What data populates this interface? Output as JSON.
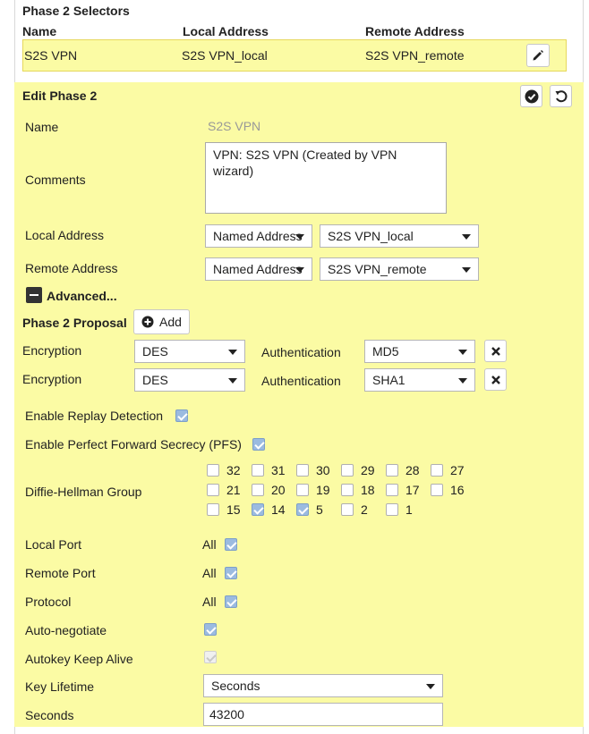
{
  "selectors": {
    "title": "Phase 2 Selectors",
    "headers": {
      "name": "Name",
      "local": "Local Address",
      "remote": "Remote Address"
    },
    "row": {
      "name": "S2S VPN",
      "local": "S2S VPN_local",
      "remote": "S2S VPN_remote"
    }
  },
  "edit": {
    "title": "Edit Phase 2",
    "name_label": "Name",
    "name_value": "S2S VPN",
    "comments_label": "Comments",
    "comments_value": "VPN: S2S VPN (Created by VPN wizard)",
    "local_label": "Local Address",
    "local_type": "Named Address",
    "local_value": "S2S VPN_local",
    "remote_label": "Remote Address",
    "remote_type": "Named Address",
    "remote_value": "S2S VPN_remote",
    "advanced_label": "Advanced...",
    "proposal_label": "Phase 2 Proposal",
    "add_label": "Add",
    "proposals": [
      {
        "enc_label": "Encryption",
        "enc_value": "DES",
        "auth_label": "Authentication",
        "auth_value": "MD5"
      },
      {
        "enc_label": "Encryption",
        "enc_value": "DES",
        "auth_label": "Authentication",
        "auth_value": "SHA1"
      }
    ],
    "replay_label": "Enable Replay Detection",
    "replay_checked": true,
    "pfs_label": "Enable Perfect Forward Secrecy (PFS)",
    "pfs_checked": true,
    "dh_label": "Diffie-Hellman Group",
    "dh_groups": [
      {
        "value": "32",
        "checked": false
      },
      {
        "value": "31",
        "checked": false
      },
      {
        "value": "30",
        "checked": false
      },
      {
        "value": "29",
        "checked": false
      },
      {
        "value": "28",
        "checked": false
      },
      {
        "value": "27",
        "checked": false
      },
      {
        "value": "21",
        "checked": false
      },
      {
        "value": "20",
        "checked": false
      },
      {
        "value": "19",
        "checked": false
      },
      {
        "value": "18",
        "checked": false
      },
      {
        "value": "17",
        "checked": false
      },
      {
        "value": "16",
        "checked": false
      },
      {
        "value": "15",
        "checked": false
      },
      {
        "value": "14",
        "checked": true
      },
      {
        "value": "5",
        "checked": true
      },
      {
        "value": "2",
        "checked": false
      },
      {
        "value": "1",
        "checked": false
      }
    ],
    "local_port_label": "Local Port",
    "local_port_all": "All",
    "remote_port_label": "Remote Port",
    "remote_port_all": "All",
    "protocol_label": "Protocol",
    "protocol_all": "All",
    "autoneg_label": "Auto-negotiate",
    "keepalive_label": "Autokey Keep Alive",
    "key_lifetime_label": "Key Lifetime",
    "key_lifetime_value": "Seconds",
    "seconds_label": "Seconds",
    "seconds_value": "43200"
  },
  "colors": {
    "highlight": "#fbfba4",
    "checkbox_on": "#9bbbe0"
  }
}
